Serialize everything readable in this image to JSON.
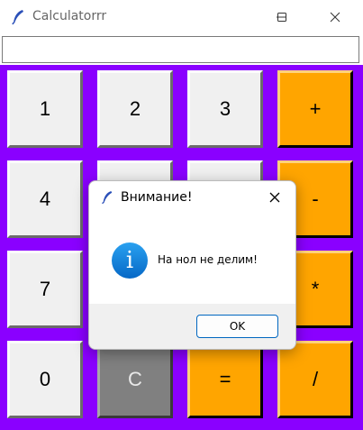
{
  "window": {
    "title": "Calculatorrr"
  },
  "entry": {
    "value": ""
  },
  "keys": [
    {
      "label": "1",
      "style": "light"
    },
    {
      "label": "2",
      "style": "light"
    },
    {
      "label": "3",
      "style": "light"
    },
    {
      "label": "+",
      "style": "op"
    },
    {
      "label": "4",
      "style": "light"
    },
    {
      "label": "",
      "style": "light"
    },
    {
      "label": "",
      "style": "light"
    },
    {
      "label": "-",
      "style": "op"
    },
    {
      "label": "7",
      "style": "light"
    },
    {
      "label": "",
      "style": "light"
    },
    {
      "label": "",
      "style": "light"
    },
    {
      "label": "*",
      "style": "op"
    },
    {
      "label": "0",
      "style": "light"
    },
    {
      "label": "C",
      "style": "clear"
    },
    {
      "label": "=",
      "style": "op"
    },
    {
      "label": "/",
      "style": "op"
    }
  ],
  "dialog": {
    "title": "Внимание!",
    "icon": "info-icon",
    "message": "На нол не делим!",
    "ok_label": "OK"
  },
  "colors": {
    "keypad_bg": "#8a00ff",
    "operator": "#ffa500",
    "clear": "#808080",
    "digit": "#f0f0f0"
  }
}
